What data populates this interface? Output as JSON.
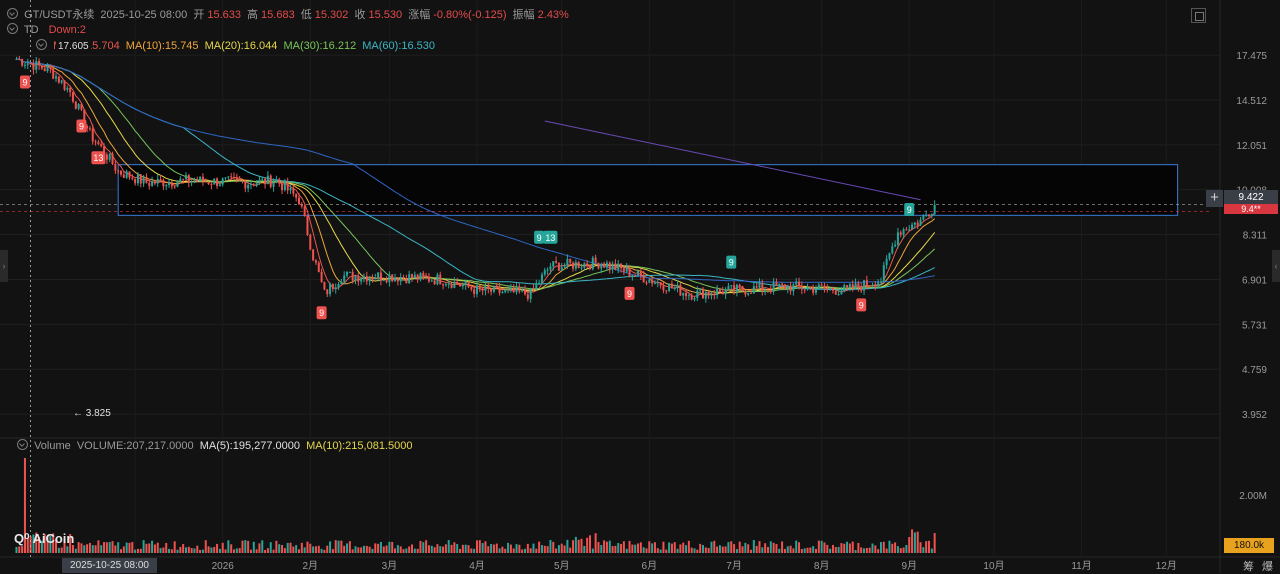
{
  "header": {
    "symbol": "GT/USDT永续",
    "datetime": "2025-10-25 08:00",
    "open_label": "开",
    "open": "15.633",
    "high_label": "高",
    "high": "15.683",
    "low_label": "低",
    "low": "15.302",
    "close_label": "收",
    "close": "15.530",
    "change_label": "涨幅",
    "change": "-0.80%(-0.125)",
    "amplitude_label": "振幅",
    "amplitude": "2.43%"
  },
  "td_indicator": {
    "name": "TD",
    "value": "Down:2"
  },
  "ma_indicator": {
    "ma5": "MA(5):15.704",
    "ma10": "MA(10):15.745",
    "ma20": "MA(20):16.044",
    "ma30": "MA(30):16.212",
    "ma60": "MA(60):16.530"
  },
  "volume_indicator": {
    "name": "Volume",
    "volume": "VOLUME:207,217.0000",
    "ma5": "MA(5):195,277.0000",
    "ma10": "MA(10):215,081.5000"
  },
  "price_tags": {
    "last": "9.422",
    "second": "9.4**"
  },
  "volume_tag": "180.0k",
  "crosshair_date": "2025-10-25 08:00",
  "extremes": {
    "high": "17.605",
    "low": "3.825"
  },
  "logo_text": "AiCoin",
  "bottom_buttons": [
    "筹",
    "爆"
  ],
  "colors": {
    "background": "#121212",
    "up": "#26a69a",
    "down": "#ef5350",
    "ma5": "#e8574f",
    "ma10": "#f0a63a",
    "ma20": "#e6d84a",
    "ma30": "#79c45a",
    "ma60": "#3bb6c6",
    "box": "#3a7bd5"
  },
  "chart_data": {
    "type": "candlestick",
    "scale": "log",
    "y_ticks": [
      "17.475",
      "14.512",
      "12.051",
      "10.008",
      "8.311",
      "6.901",
      "5.731",
      "4.759",
      "3.952"
    ],
    "y_tick_values": [
      17.475,
      14.512,
      12.051,
      10.008,
      8.311,
      6.901,
      5.731,
      4.759,
      3.952
    ],
    "x_ticks": [
      "12月",
      "2026",
      "2月",
      "3月",
      "4月",
      "5月",
      "6月",
      "7月",
      "8月",
      "9月",
      "10月",
      "11月",
      "12月"
    ],
    "volume_ticks": [
      "2.00M"
    ],
    "price_path": [
      {
        "t": "2025-10-20",
        "p": 17.2
      },
      {
        "t": "2025-11-01",
        "p": 16.4
      },
      {
        "t": "2025-11-08",
        "p": 15.0
      },
      {
        "t": "2025-11-15",
        "p": 12.6
      },
      {
        "t": "2025-11-25",
        "p": 10.8
      },
      {
        "t": "2025-12-05",
        "p": 10.3
      },
      {
        "t": "2025-12-20",
        "p": 10.4
      },
      {
        "t": "2026-01-10",
        "p": 10.3
      },
      {
        "t": "2026-01-20",
        "p": 10.4
      },
      {
        "t": "2026-01-28",
        "p": 9.6
      },
      {
        "t": "2026-02-02",
        "p": 7.6
      },
      {
        "t": "2026-02-06",
        "p": 6.5
      },
      {
        "t": "2026-02-12",
        "p": 7.0
      },
      {
        "t": "2026-03-01",
        "p": 7.0
      },
      {
        "t": "2026-03-20",
        "p": 6.9
      },
      {
        "t": "2026-04-01",
        "p": 6.6
      },
      {
        "t": "2026-04-20",
        "p": 6.5
      },
      {
        "t": "2026-04-27",
        "p": 7.3
      },
      {
        "t": "2026-05-15",
        "p": 7.4
      },
      {
        "t": "2026-06-01",
        "p": 6.9
      },
      {
        "t": "2026-06-15",
        "p": 6.5
      },
      {
        "t": "2026-07-01",
        "p": 6.6
      },
      {
        "t": "2026-07-20",
        "p": 6.7
      },
      {
        "t": "2026-08-10",
        "p": 6.6
      },
      {
        "t": "2026-08-22",
        "p": 6.9
      },
      {
        "t": "2026-08-28",
        "p": 8.4
      },
      {
        "t": "2026-09-05",
        "p": 8.8
      },
      {
        "t": "2026-09-10",
        "p": 9.4
      }
    ],
    "range_box": {
      "from": "2025-11-25",
      "to": "2026-12-05",
      "high": 11.1,
      "low": 9.0
    },
    "td_markers": [
      {
        "label": "9",
        "t": "2025-10-23",
        "p": 15.6,
        "type": "down"
      },
      {
        "label": "9",
        "t": "2025-11-12",
        "p": 13.0,
        "type": "down"
      },
      {
        "label": "13",
        "t": "2025-11-18",
        "p": 11.4,
        "type": "down"
      },
      {
        "label": "9",
        "t": "2026-02-05",
        "p": 6.0,
        "type": "down"
      },
      {
        "label": "9",
        "t": "2026-04-23",
        "p": 8.2,
        "type": "up"
      },
      {
        "label": "13",
        "t": "2026-04-27",
        "p": 8.2,
        "type": "up"
      },
      {
        "label": "9",
        "t": "2026-05-25",
        "p": 6.5,
        "type": "down"
      },
      {
        "label": "9",
        "t": "2026-06-30",
        "p": 7.4,
        "type": "up"
      },
      {
        "label": "9",
        "t": "2026-08-15",
        "p": 6.2,
        "type": "down"
      },
      {
        "label": "9",
        "t": "2026-09-01",
        "p": 9.2,
        "type": "up"
      }
    ]
  }
}
